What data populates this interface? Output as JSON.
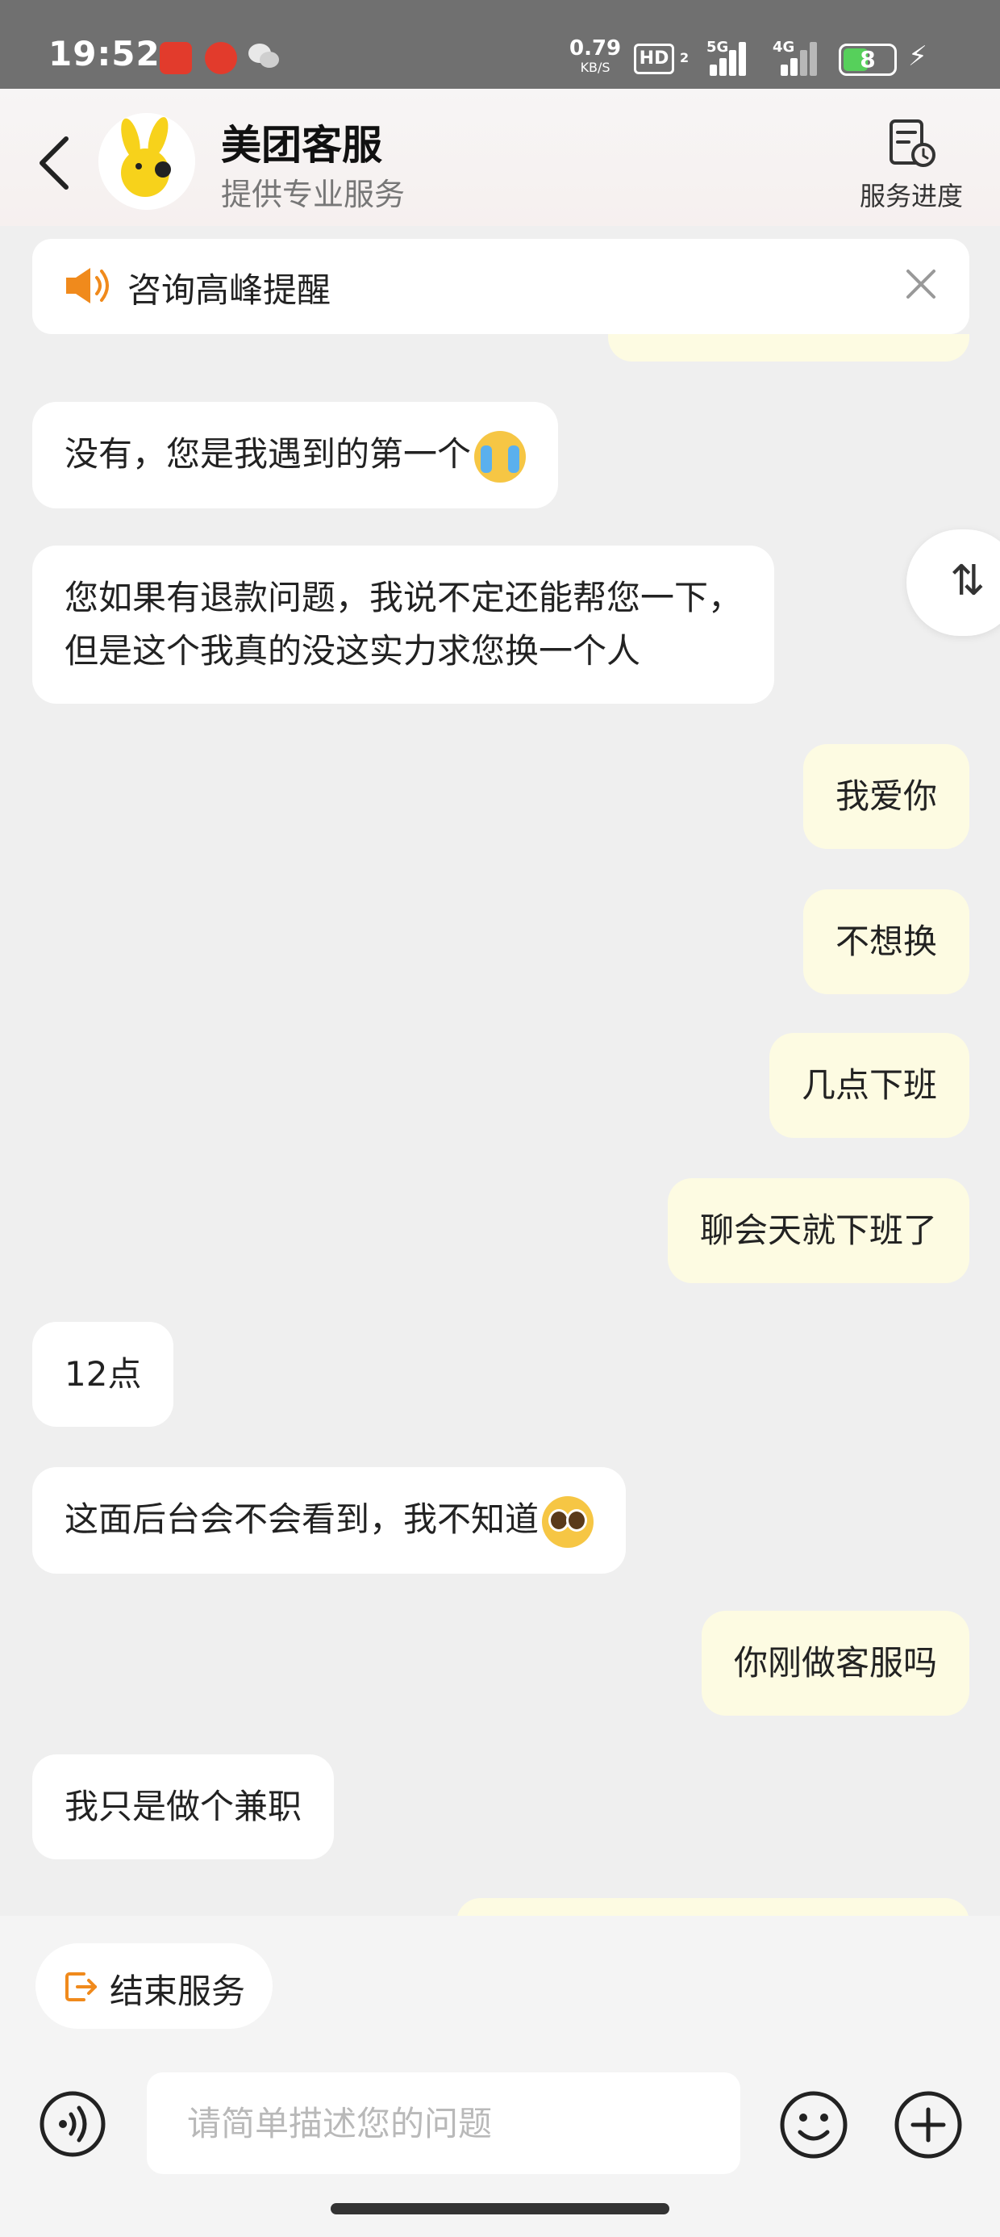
{
  "status_bar": {
    "time": "19:52",
    "network_speed": "0.79",
    "network_speed_unit": "KB/S",
    "hd_label": "HD",
    "hd_sub": "2",
    "net_label_1": "5G",
    "net_label_2": "4G",
    "battery": "8",
    "icons": [
      "tingshu-app-icon",
      "netease-music-icon",
      "wechat-icon",
      "signal-icon",
      "battery-icon",
      "charging-icon"
    ]
  },
  "header": {
    "name": "美团客服",
    "subtitle": "提供专业服务",
    "progress_label": "服务进度",
    "avatar_color": "#f7d21b"
  },
  "notice": {
    "text": "咨询高峰提醒",
    "accent": "#f08a1c"
  },
  "messages": [
    {
      "side": "left",
      "text": "没有，您是我遇到的第一个",
      "emoji": "crying-emoji"
    },
    {
      "side": "left",
      "line1": "您如果有退款问题，我说不定还能帮您一下，",
      "line2": "但是这个我真的没这实力求您换一个人"
    },
    {
      "side": "right",
      "text": "我爱你"
    },
    {
      "side": "right",
      "text": "不想换"
    },
    {
      "side": "right",
      "text": "几点下班"
    },
    {
      "side": "right",
      "text": "聊会天就下班了"
    },
    {
      "side": "left",
      "text": "12点"
    },
    {
      "side": "left",
      "text": "这面后台会不会看到，我不知道",
      "emoji": "pleading-emoji"
    },
    {
      "side": "right",
      "text": "你刚做客服吗"
    },
    {
      "side": "left",
      "text": "我只是做个兼职"
    }
  ],
  "scroll_button_glyph": "⇅",
  "quick_actions": {
    "end_service": "结束服务"
  },
  "input": {
    "placeholder": "请简单描述您的问题"
  },
  "colors": {
    "bubble_right": "#fdfbe2",
    "bubble_left": "#ffffff",
    "accent_orange": "#f08a1c"
  }
}
